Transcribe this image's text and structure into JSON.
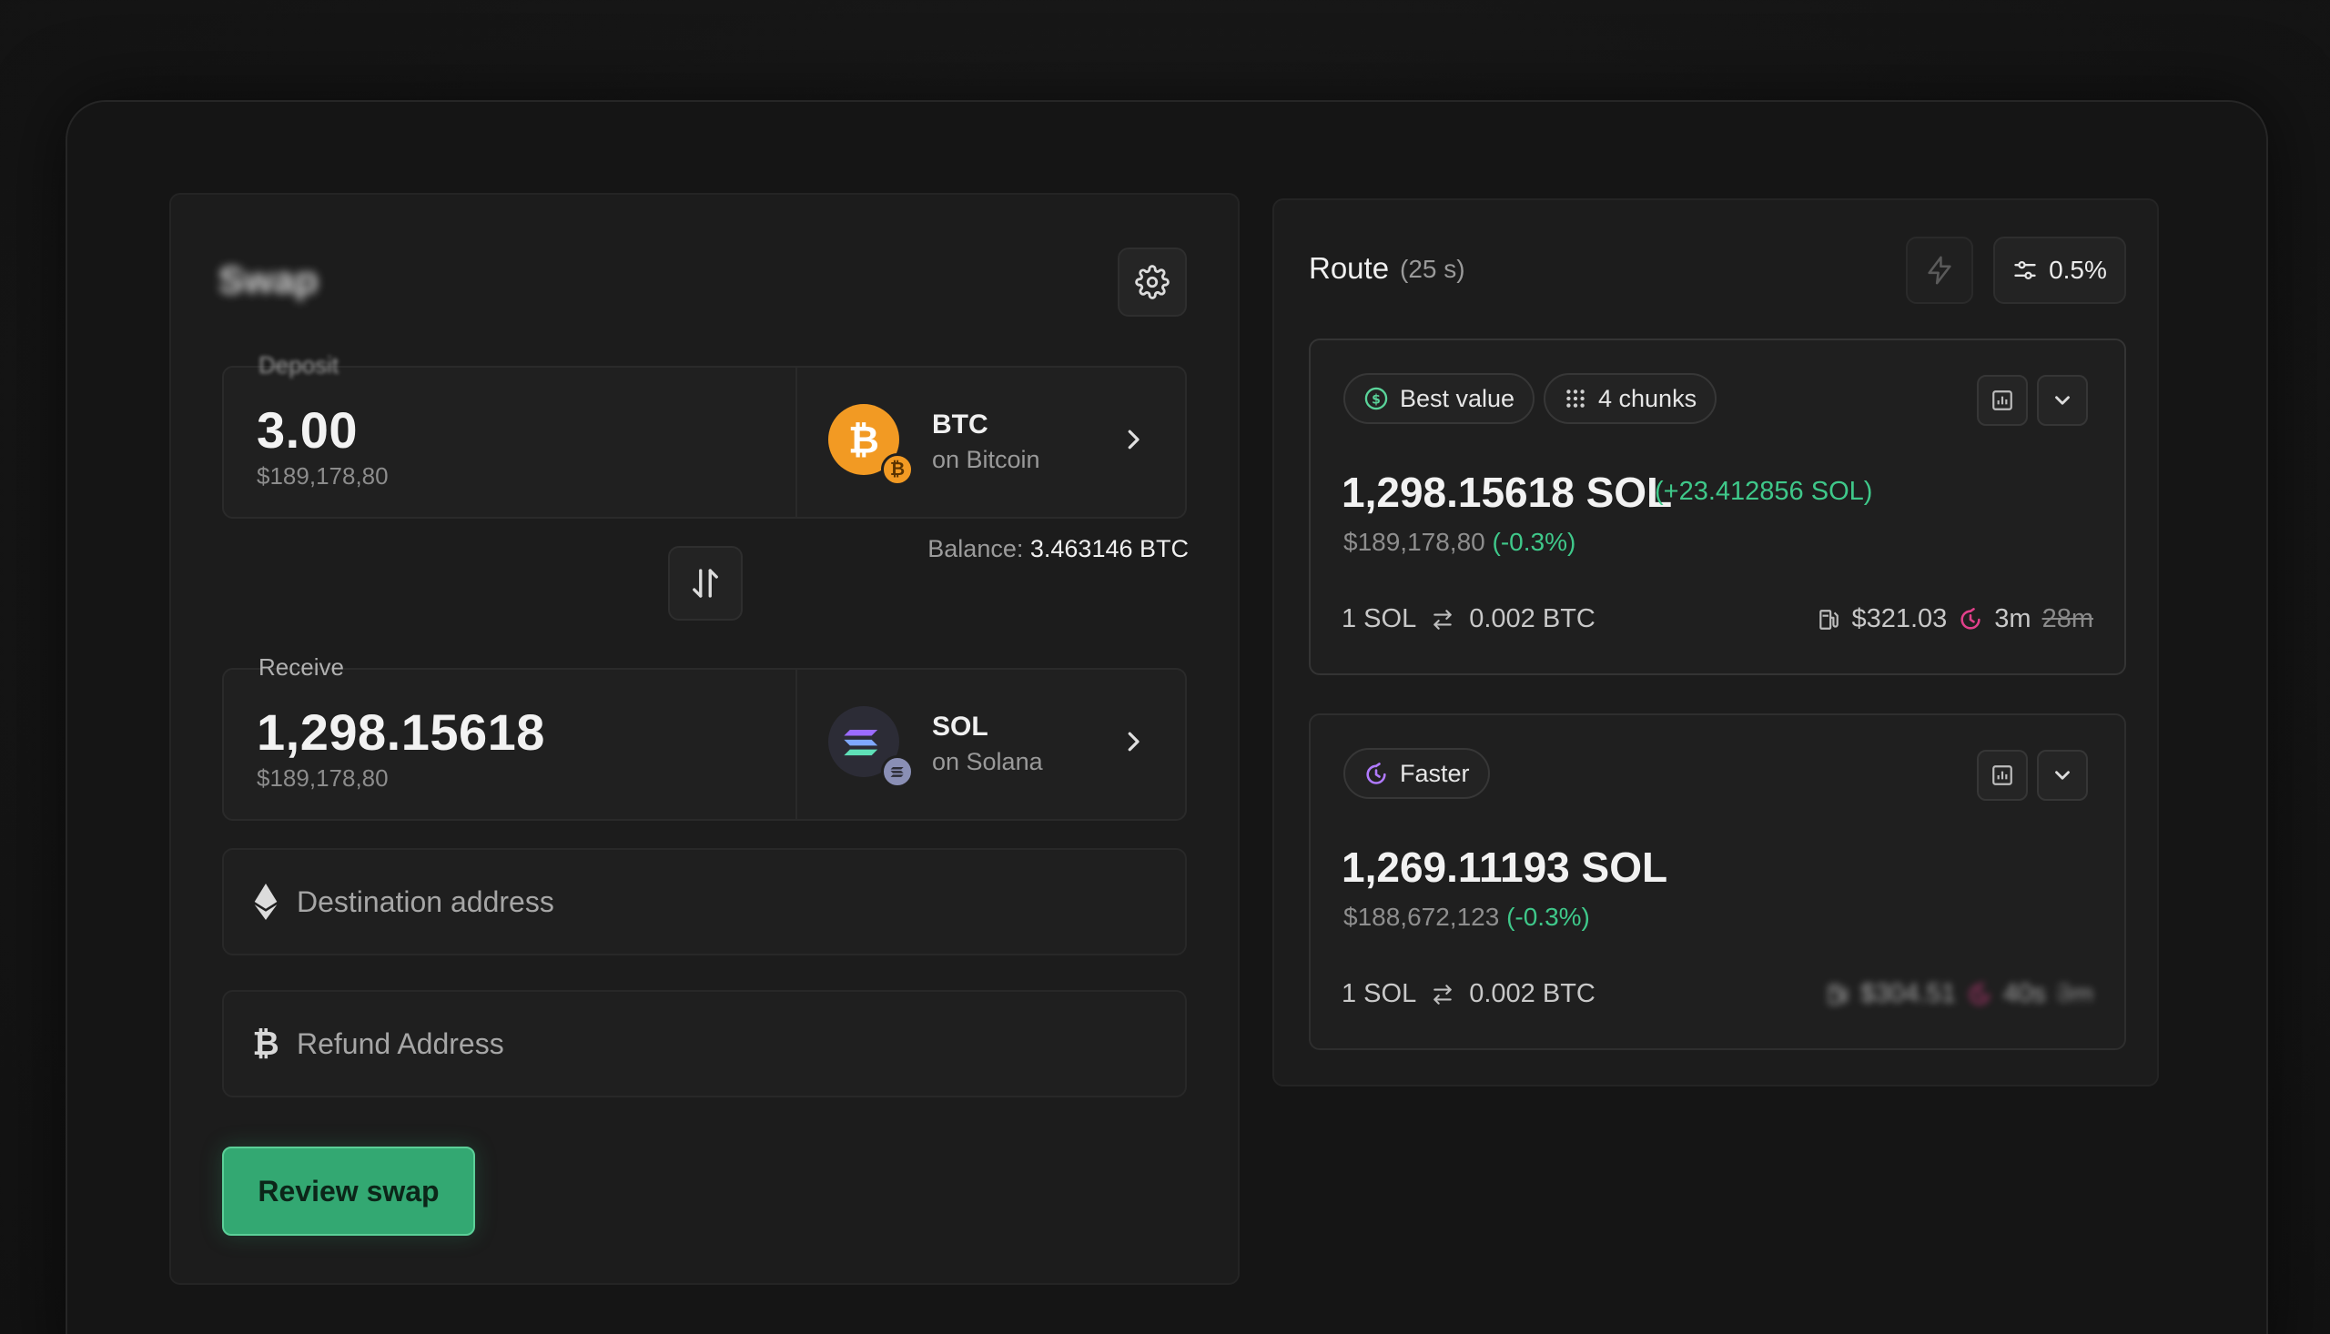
{
  "swap": {
    "title": "Swap",
    "settings_icon": "gear-icon",
    "deposit": {
      "label": "Deposit",
      "amount": "3.00",
      "usd": "$189,178,80",
      "token_symbol": "BTC",
      "token_chain": "on Bitcoin",
      "balance_label": "Balance:",
      "balance_value": "3.463146 BTC"
    },
    "receive": {
      "label": "Receive",
      "amount": "1,298.15618",
      "usd": "$189,178,80",
      "token_symbol": "SOL",
      "token_chain": "on Solana"
    },
    "destination": {
      "placeholder": "Destination address",
      "value": ""
    },
    "refund": {
      "placeholder": "Refund Address",
      "value": "",
      "icon_glyph": "₿"
    },
    "btc_badge_glyph": "₿",
    "review_label": "Review swap"
  },
  "route": {
    "title": "Route",
    "timer": "(25 s)",
    "slippage": "0.5%",
    "cards": [
      {
        "tag": "Best value",
        "chunks": "4 chunks",
        "amount": "1,298.15618 SOL",
        "diff": "(+23.412856 SOL)",
        "usd": "$189,178,80",
        "pct": "(-0.3%)",
        "rate_left": "1 SOL",
        "rate_right": "0.002 BTC",
        "fee": "$321.03",
        "time": "3m",
        "time_old": "28m"
      },
      {
        "tag": "Faster",
        "amount": "1,269.11193 SOL",
        "usd": "$188,672,123",
        "pct": "(-0.3%)",
        "rate_left": "1 SOL",
        "rate_right": "0.002 BTC",
        "fee": "$304.51",
        "time": "40s",
        "time_old": "3m"
      }
    ]
  },
  "colors": {
    "accent_green": "#33a872",
    "positive": "#3fc88a",
    "btc_orange": "#f29a23",
    "timer_pink": "#e0408a"
  }
}
